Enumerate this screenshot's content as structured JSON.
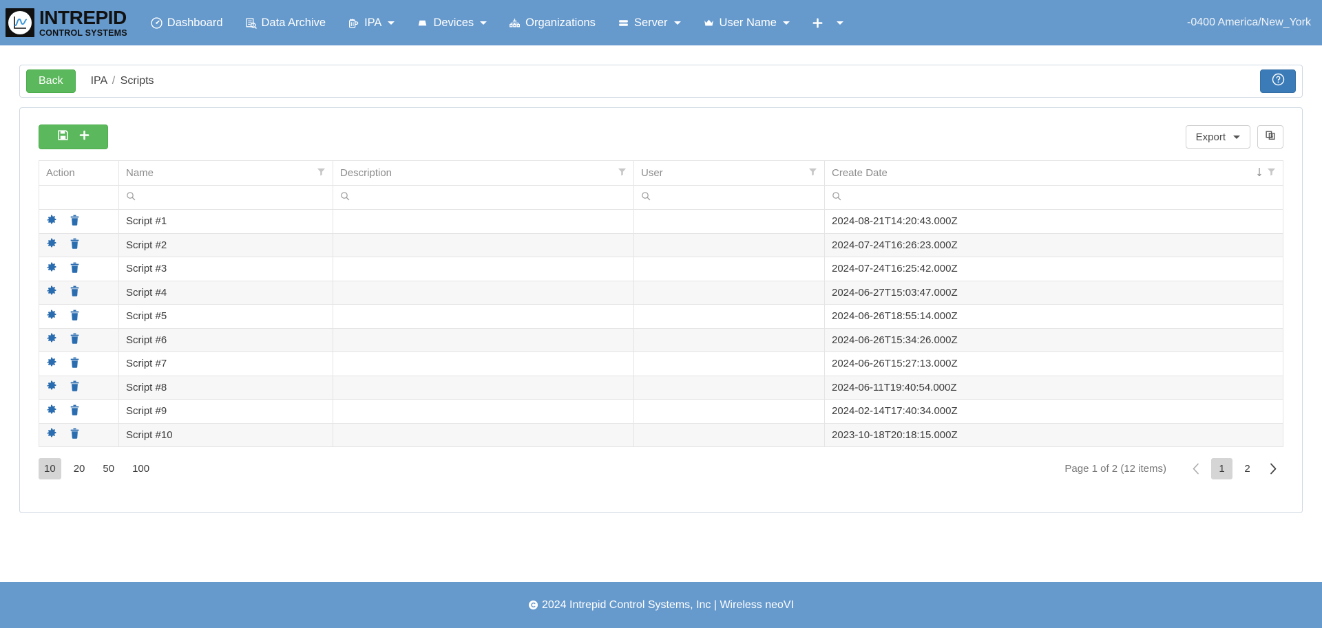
{
  "navbar": {
    "brand": {
      "line1": "INTREPID",
      "line2": "CONTROL SYSTEMS",
      "logo_icon": "waveform-graph-logo"
    },
    "items": [
      {
        "label": "Dashboard",
        "icon": "dashboard-gauge-icon",
        "caret": false
      },
      {
        "label": "Data Archive",
        "icon": "data-archive-icon",
        "caret": false
      },
      {
        "label": "IPA",
        "icon": "beer-mug-icon",
        "caret": true
      },
      {
        "label": "Devices",
        "icon": "device-icon",
        "caret": true
      },
      {
        "label": "Organizations",
        "icon": "organizations-icon",
        "caret": false
      },
      {
        "label": "Server",
        "icon": "server-icon",
        "caret": true
      },
      {
        "label": "User Name",
        "icon": "crown-icon",
        "caret": true
      },
      {
        "label": "",
        "icon": "plus-icon",
        "caret": true
      }
    ],
    "timezone": "-0400 America/New_York"
  },
  "breadcrumb": {
    "back_label": "Back",
    "root": "IPA",
    "separator": "/",
    "current": "Scripts",
    "help_icon": "question-circle-icon"
  },
  "toolbar": {
    "add_button": {
      "save_icon": "floppy-save-icon",
      "plus_icon": "plus-icon"
    },
    "export_label": "Export",
    "export_caret_icon": "caret-down-icon",
    "columns_icon": "copy-columns-icon"
  },
  "grid": {
    "columns": [
      {
        "label": "Action",
        "filter": false,
        "sort": null
      },
      {
        "label": "Name",
        "filter": true,
        "sort": null
      },
      {
        "label": "Description",
        "filter": true,
        "sort": null
      },
      {
        "label": "User",
        "filter": true,
        "sort": null
      },
      {
        "label": "Create Date",
        "filter": true,
        "sort": "desc"
      }
    ],
    "search_icon": "magnifier-icon",
    "filter_icon": "funnel-filter-icon",
    "sort_desc_icon": "arrow-down-icon",
    "row_icons": {
      "settings": "gear-icon",
      "delete": "trash-icon"
    },
    "rows": [
      {
        "name": "Script #1",
        "description": "",
        "user": "",
        "create_date": "2024-08-21T14:20:43.000Z"
      },
      {
        "name": "Script #2",
        "description": "",
        "user": "",
        "create_date": "2024-07-24T16:26:23.000Z"
      },
      {
        "name": "Script #3",
        "description": "",
        "user": "",
        "create_date": "2024-07-24T16:25:42.000Z"
      },
      {
        "name": "Script #4",
        "description": "",
        "user": "",
        "create_date": "2024-06-27T15:03:47.000Z"
      },
      {
        "name": "Script #5",
        "description": "",
        "user": "",
        "create_date": "2024-06-26T18:55:14.000Z"
      },
      {
        "name": "Script #6",
        "description": "",
        "user": "",
        "create_date": "2024-06-26T15:34:26.000Z"
      },
      {
        "name": "Script #7",
        "description": "",
        "user": "",
        "create_date": "2024-06-26T15:27:13.000Z"
      },
      {
        "name": "Script #8",
        "description": "",
        "user": "",
        "create_date": "2024-06-11T19:40:54.000Z"
      },
      {
        "name": "Script #9",
        "description": "",
        "user": "",
        "create_date": "2024-02-14T17:40:34.000Z"
      },
      {
        "name": "Script #10",
        "description": "",
        "user": "",
        "create_date": "2023-10-18T20:18:15.000Z"
      }
    ]
  },
  "pager": {
    "page_sizes": [
      "10",
      "20",
      "50",
      "100"
    ],
    "active_size": "10",
    "info": "Page 1 of 2 (12 items)",
    "pages": [
      "1",
      "2"
    ],
    "active_page": "1",
    "prev_icon": "chevron-left-icon",
    "next_icon": "chevron-right-icon"
  },
  "footer": {
    "copyright_icon": "copyright-icon",
    "text": "2024 Intrepid Control Systems, Inc | Wireless neoVI"
  },
  "colors": {
    "brand_blue": "#6699cc",
    "green": "#5cb85c",
    "help_blue": "#3b7cb8",
    "icon_blue": "#2a6cb0"
  }
}
